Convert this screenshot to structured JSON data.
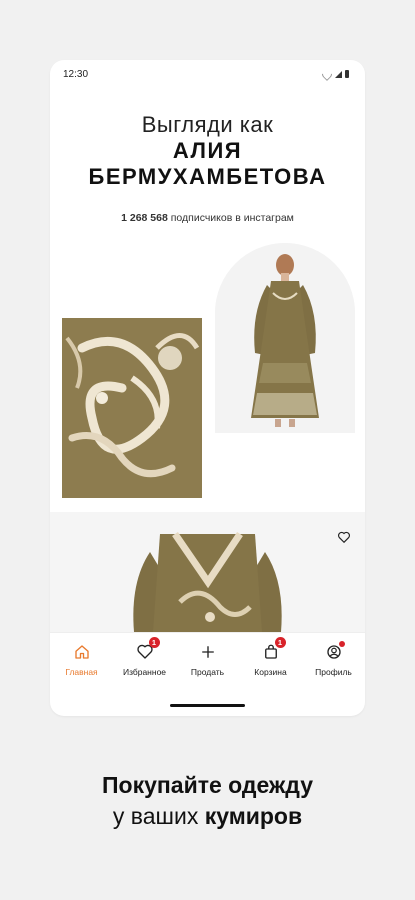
{
  "status_bar": {
    "time": "12:30"
  },
  "hero": {
    "title_line1": "Выгляди как",
    "title_line2": "АЛИЯ",
    "title_line3": "БЕРМУХАМБЕТОВА",
    "followers_count": "1 268 568",
    "followers_suffix": "подписчиков в инстаграм"
  },
  "tabbar": {
    "items": [
      {
        "label": "Главная",
        "icon": "home-icon",
        "active": true
      },
      {
        "label": "Избранное",
        "icon": "heart-icon",
        "badge": "1"
      },
      {
        "label": "Продать",
        "icon": "plus-icon"
      },
      {
        "label": "Корзина",
        "icon": "bag-icon",
        "badge": "1"
      },
      {
        "label": "Профиль",
        "icon": "profile-icon"
      }
    ]
  },
  "caption": {
    "line1": "Покупайте одежду",
    "line2_prefix": "у ваших",
    "line2_bold": "кумиров"
  },
  "colors": {
    "accent": "#e87a2e",
    "badge": "#d8232a",
    "fabric": "#8d7c4f"
  }
}
